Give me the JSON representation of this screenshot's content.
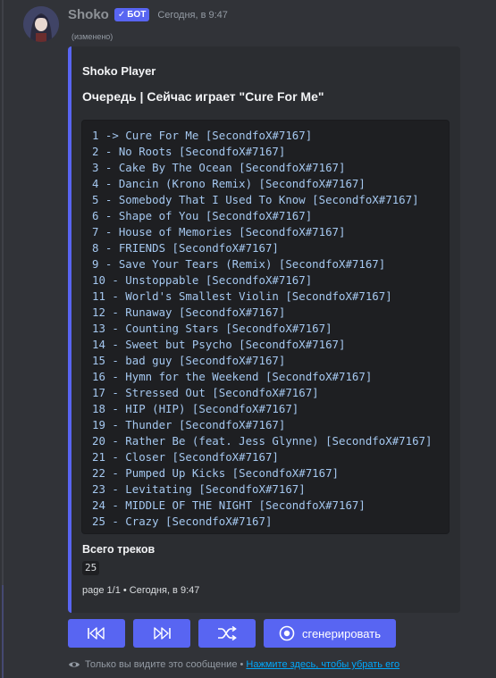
{
  "message": {
    "username": "Shoko",
    "bot_tag": "БОТ",
    "timestamp": "Сегодня, в 9:47",
    "edited": "(изменено)"
  },
  "embed": {
    "accent_color": "#5865f2",
    "author": "Shoko Player",
    "title": "Очередь | Сейчас играет \"Cure For Me\"",
    "queue": [
      "1 -> Cure For Me [SecondfoX#7167]",
      "2 - No Roots [SecondfoX#7167]",
      "3 - Cake By The Ocean [SecondfoX#7167]",
      "4 - Dancin (Krono Remix) [SecondfoX#7167]",
      "5 - Somebody That I Used To Know [SecondfoX#7167]",
      "6 - Shape of You [SecondfoX#7167]",
      "7 - House of Memories [SecondfoX#7167]",
      "8 - FRIENDS [SecondfoX#7167]",
      "9 - Save Your Tears (Remix) [SecondfoX#7167]",
      "10 - Unstoppable [SecondfoX#7167]",
      "11 - World's Smallest Violin [SecondfoX#7167]",
      "12 - Runaway [SecondfoX#7167]",
      "13 - Counting Stars [SecondfoX#7167]",
      "14 - Sweet but Psycho [SecondfoX#7167]",
      "15 - bad guy [SecondfoX#7167]",
      "16 - Hymn for the Weekend [SecondfoX#7167]",
      "17 - Stressed Out [SecondfoX#7167]",
      "18 - HIP (HIP) [SecondfoX#7167]",
      "19 - Thunder [SecondfoX#7167]",
      "20 - Rather Be (feat. Jess Glynne) [SecondfoX#7167]",
      "21 - Closer [SecondfoX#7167]",
      "22 - Pumped Up Kicks [SecondfoX#7167]",
      "23 - Levitating [SecondfoX#7167]",
      "24 - MIDDLE OF THE NIGHT [SecondfoX#7167]",
      "25 - Crazy [SecondfoX#7167]"
    ],
    "field_name": "Всего треков",
    "field_value": "25",
    "footer": "page 1/1 • Сегодня, в 9:47"
  },
  "buttons": {
    "previous_icon": "skip-previous-icon",
    "next_icon": "skip-next-icon",
    "shuffle_icon": "shuffle-icon",
    "generate_icon": "record-icon",
    "generate_label": "сгенерировать"
  },
  "ephemeral": {
    "icon": "eye-icon",
    "text": "Только вы видите это сообщение •",
    "link": "Нажмите здесь, чтобы убрать его"
  }
}
